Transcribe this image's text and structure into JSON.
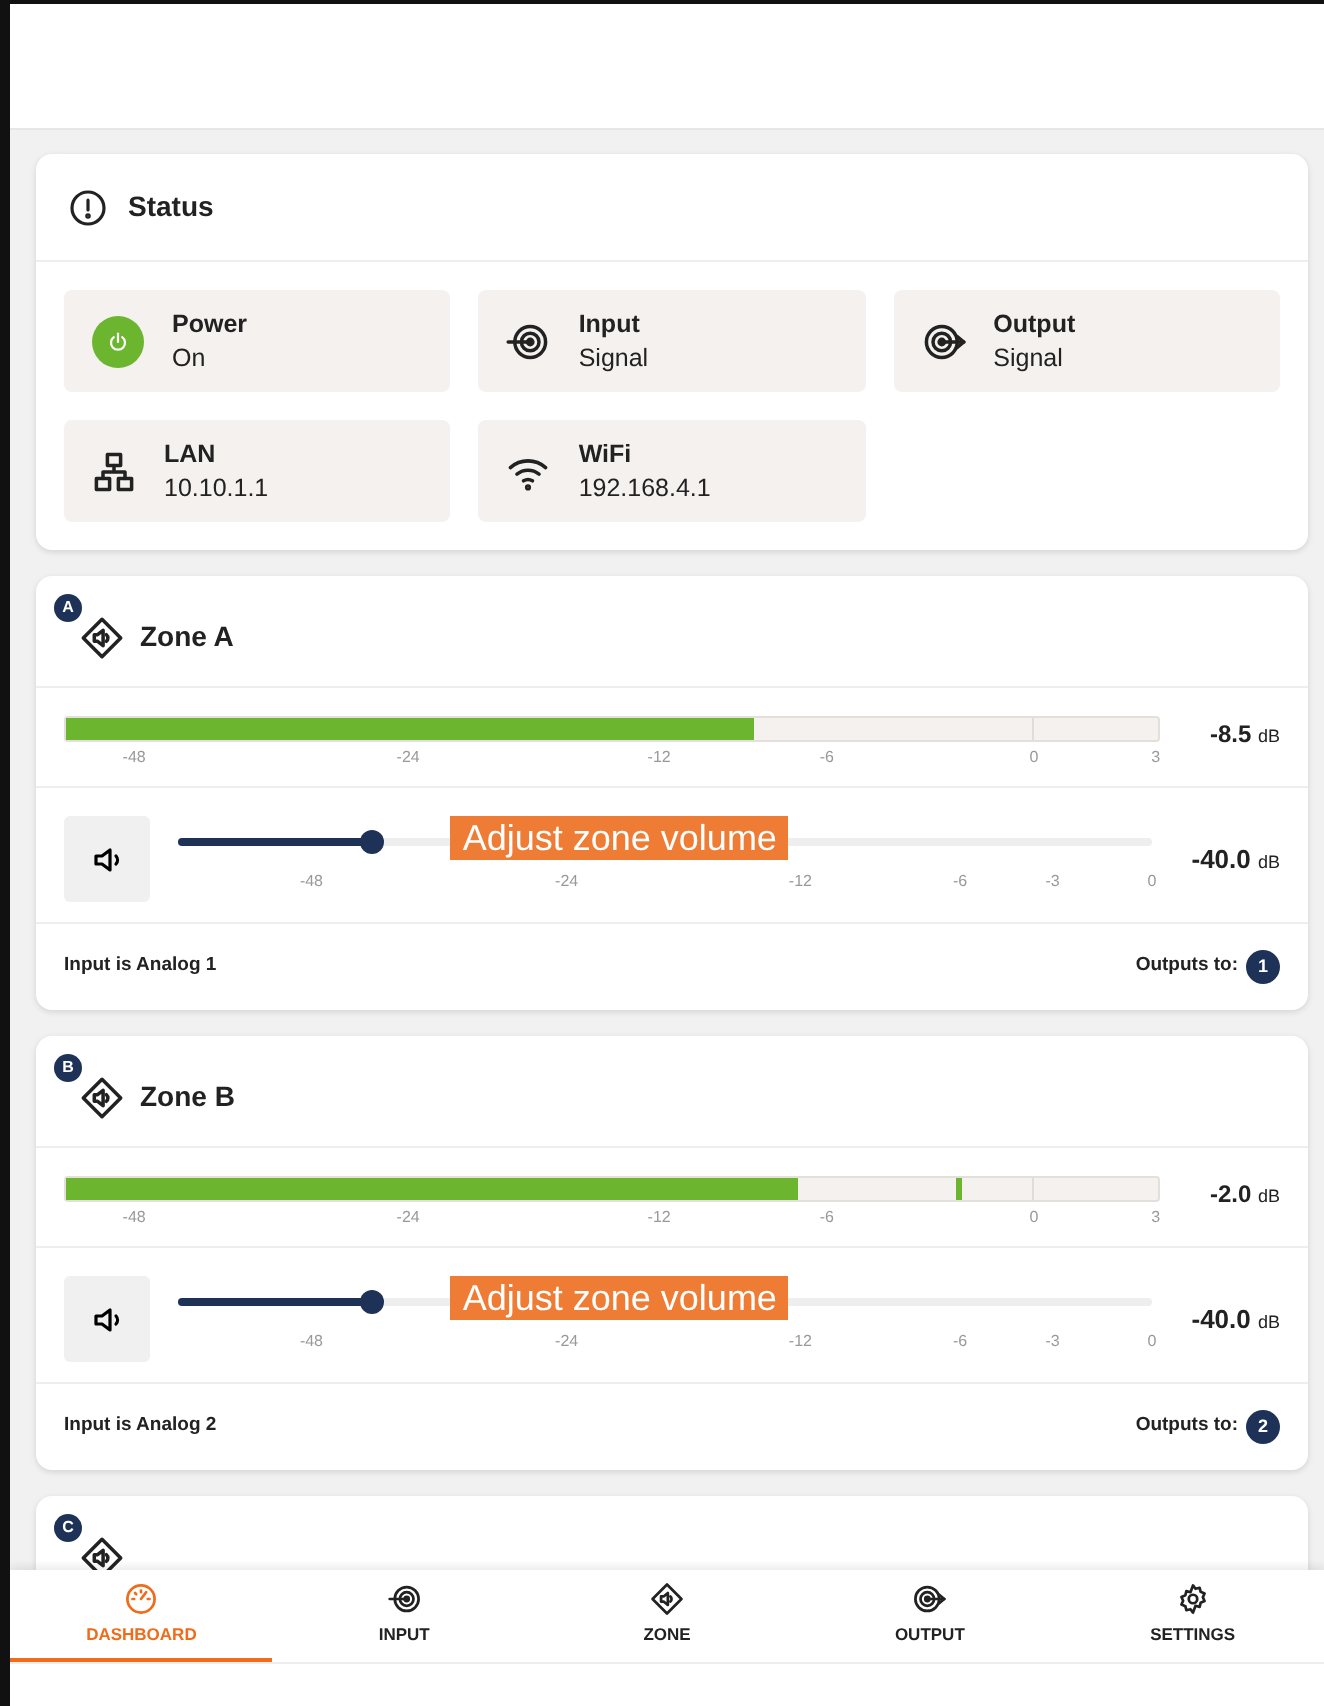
{
  "status": {
    "title": "Status",
    "tiles": [
      {
        "kind": "power",
        "label": "Power",
        "value": "On",
        "on": true
      },
      {
        "kind": "input",
        "label": "Input",
        "value": "Signal"
      },
      {
        "kind": "output",
        "label": "Output",
        "value": "Signal"
      },
      {
        "kind": "lan",
        "label": "LAN",
        "value": "10.10.1.1"
      },
      {
        "kind": "wifi",
        "label": "WiFi",
        "value": "192.168.4.1"
      }
    ]
  },
  "zones": [
    {
      "badge": "A",
      "title": "Zone A",
      "meter": {
        "level": 0.63,
        "reading": "-8.5",
        "unit": "dB",
        "ticks": [
          "-48",
          "-24",
          "-12",
          "-6",
          "0",
          "3"
        ]
      },
      "volume": {
        "level": 0.2,
        "reading": "-40.0",
        "unit": "dB",
        "tooltip": "Adjust zone volume",
        "ticks": [
          "-48",
          "-24",
          "-12",
          "-6",
          "-3",
          "0"
        ]
      },
      "input": "Input is Analog 1",
      "outputs_label": "Outputs to:",
      "outputs": [
        "1"
      ]
    },
    {
      "badge": "B",
      "title": "Zone B",
      "meter": {
        "level": 0.67,
        "peak": {
          "level": 0.815
        },
        "reading": "-2.0",
        "unit": "dB",
        "ticks": [
          "-48",
          "-24",
          "-12",
          "-6",
          "0",
          "3"
        ]
      },
      "volume": {
        "level": 0.2,
        "reading": "-40.0",
        "unit": "dB",
        "tooltip": "Adjust zone volume",
        "ticks": [
          "-48",
          "-24",
          "-12",
          "-6",
          "-3",
          "0"
        ]
      },
      "input": "Input is Analog 2",
      "outputs_label": "Outputs to:",
      "outputs": [
        "2"
      ]
    },
    {
      "badge": "C"
    }
  ],
  "nav": [
    {
      "kind": "dashboard",
      "label": "DASHBOARD",
      "selected": true
    },
    {
      "kind": "input",
      "label": "INPUT",
      "selected": false
    },
    {
      "kind": "zone",
      "label": "ZONE",
      "selected": false
    },
    {
      "kind": "output",
      "label": "OUTPUT",
      "selected": false
    },
    {
      "kind": "settings",
      "label": "SETTINGS",
      "selected": false
    }
  ]
}
